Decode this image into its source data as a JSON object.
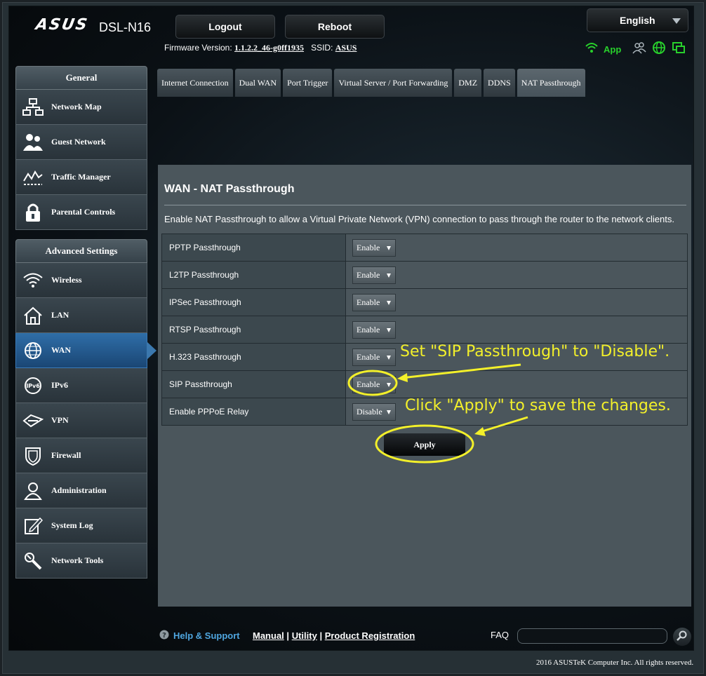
{
  "header": {
    "brand": "ASUS",
    "model": "DSL-N16",
    "logout_label": "Logout",
    "reboot_label": "Reboot",
    "language": "English",
    "firmware_label": "Firmware Version:",
    "firmware_value": "1.1.2.2_46-g0ff1935",
    "ssid_label": "SSID:",
    "ssid_value": "ASUS",
    "app_label": "App"
  },
  "sidebar": {
    "general_title": "General",
    "general_items": [
      {
        "label": "Network Map",
        "icon": "network-map-icon"
      },
      {
        "label": "Guest Network",
        "icon": "guest-network-icon"
      },
      {
        "label": "Traffic Manager",
        "icon": "traffic-manager-icon"
      },
      {
        "label": "Parental Controls",
        "icon": "lock-icon"
      }
    ],
    "advanced_title": "Advanced Settings",
    "advanced_items": [
      {
        "label": "Wireless",
        "icon": "wifi-icon"
      },
      {
        "label": "LAN",
        "icon": "home-icon"
      },
      {
        "label": "WAN",
        "icon": "globe-icon"
      },
      {
        "label": "IPv6",
        "icon": "ipv6-icon"
      },
      {
        "label": "VPN",
        "icon": "vpn-icon"
      },
      {
        "label": "Firewall",
        "icon": "shield-icon"
      },
      {
        "label": "Administration",
        "icon": "user-icon"
      },
      {
        "label": "System Log",
        "icon": "edit-icon"
      },
      {
        "label": "Network Tools",
        "icon": "tools-icon"
      }
    ]
  },
  "tabs": [
    "Internet Connection",
    "Dual WAN",
    "Port Trigger",
    "Virtual Server / Port Forwarding",
    "DMZ",
    "DDNS",
    "NAT Passthrough"
  ],
  "main": {
    "title": "WAN - NAT Passthrough",
    "description": "Enable NAT Passthrough to allow a Virtual Private Network (VPN) connection to pass through the router to the network clients.",
    "rows": [
      {
        "label": "PPTP Passthrough",
        "value": "Enable"
      },
      {
        "label": "L2TP Passthrough",
        "value": "Enable"
      },
      {
        "label": "IPSec Passthrough",
        "value": "Enable"
      },
      {
        "label": "RTSP Passthrough",
        "value": "Enable"
      },
      {
        "label": "H.323 Passthrough",
        "value": "Enable"
      },
      {
        "label": "SIP Passthrough",
        "value": "Enable"
      },
      {
        "label": "Enable PPPoE Relay",
        "value": "Disable"
      }
    ],
    "apply_label": "Apply"
  },
  "annotations": {
    "note1": "Set \"SIP Passthrough\" to \"Disable\".",
    "note2": "Click \"Apply\" to save the changes.",
    "color": "#f3f02a"
  },
  "footer": {
    "help": "Help & Support",
    "manual": "Manual",
    "utility": "Utility",
    "registration": "Product Registration",
    "separator": "|",
    "faq": "FAQ",
    "copyright": "2016 ASUSTeK Computer Inc. All rights reserved."
  }
}
